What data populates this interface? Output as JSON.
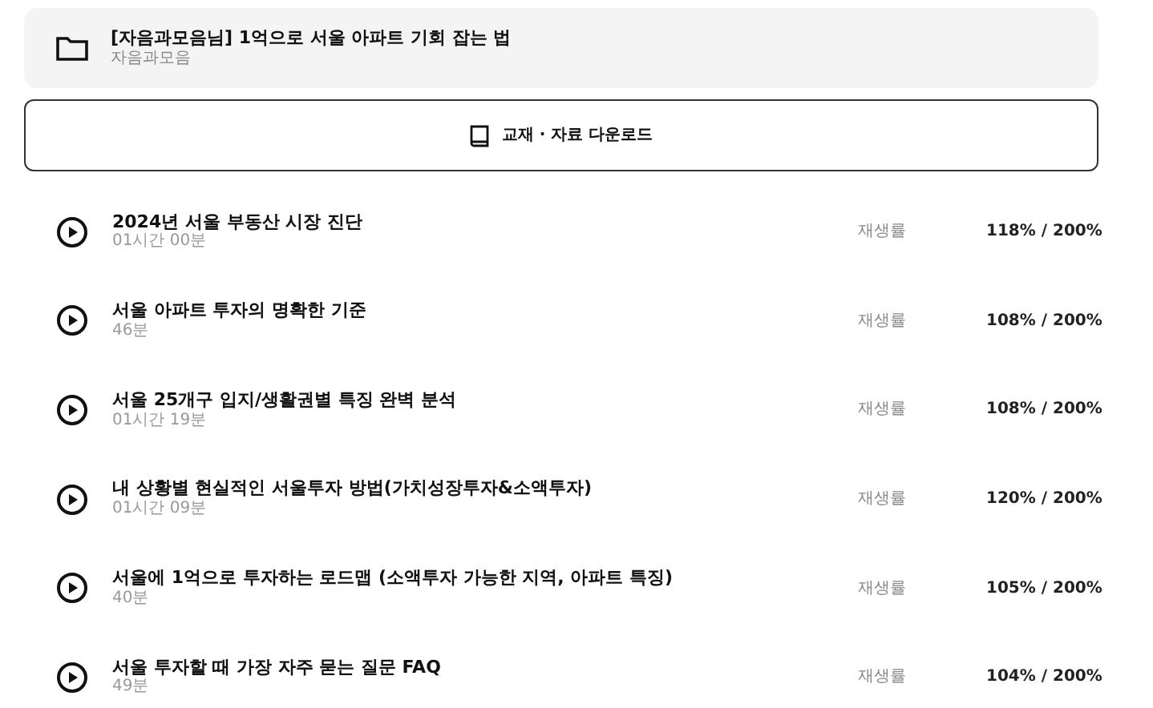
{
  "course": {
    "title": "[자음과모음님] 1억으로 서울 아파트 기회 잡는 법",
    "author": "자음과모음"
  },
  "download_button": {
    "label": "교재 · 자료 다운로드"
  },
  "lessons": [
    {
      "title": "2024년 서울 부동산 시장 진단",
      "duration": "01시간 00분",
      "rate_label": "재생률",
      "rate": "118% / 200%"
    },
    {
      "title": "서울 아파트 투자의 명확한 기준",
      "duration": "46분",
      "rate_label": "재생률",
      "rate": "108% / 200%"
    },
    {
      "title": "서울 25개구 입지/생활권별 특징 완벽 분석",
      "duration": "01시간 19분",
      "rate_label": "재생률",
      "rate": "108% / 200%"
    },
    {
      "title": "내 상황별 현실적인 서울투자 방법(가치성장투자&소액투자)",
      "duration": "01시간 09분",
      "rate_label": "재생률",
      "rate": "120% / 200%"
    },
    {
      "title": "서울에 1억으로 투자하는 로드맵 (소액투자 가능한 지역, 아파트 특징)",
      "duration": "40분",
      "rate_label": "재생률",
      "rate": "105% / 200%"
    },
    {
      "title": "서울 투자할 때 가장 자주 묻는 질문 FAQ",
      "duration": "49분",
      "rate_label": "재생률",
      "rate": "104% / 200%"
    }
  ]
}
